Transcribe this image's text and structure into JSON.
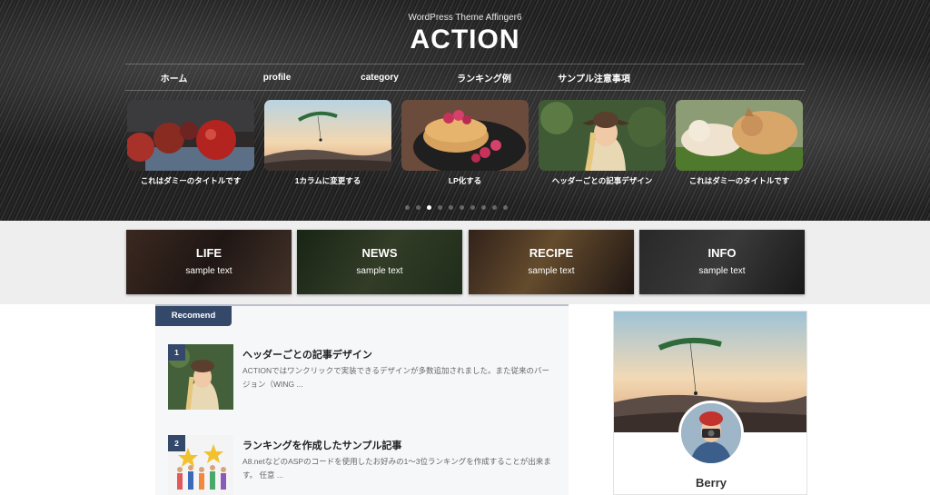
{
  "header": {
    "tagline": "WordPress Theme Affinger6",
    "logo": "ACTION"
  },
  "nav": {
    "items": [
      "ホーム",
      "profile",
      "category",
      "ランキング例",
      "サンプル注意事項"
    ]
  },
  "slider": {
    "slides": [
      {
        "caption": "これはダミーのタイトルです",
        "image": "apples"
      },
      {
        "caption": "1カラムに変更する",
        "image": "paraglider"
      },
      {
        "caption": "LP化する",
        "image": "pancakes"
      },
      {
        "caption": "ヘッダーごとの記事デザイン",
        "image": "woman-hat"
      },
      {
        "caption": "これはダミーのタイトルです",
        "image": "dog-cat"
      }
    ],
    "dots_total": 10,
    "active_dot": 2
  },
  "categories": [
    {
      "title": "LIFE",
      "sub": "sample text"
    },
    {
      "title": "NEWS",
      "sub": "sample text"
    },
    {
      "title": "RECIPE",
      "sub": "sample text"
    },
    {
      "title": "INFO",
      "sub": "sample text"
    }
  ],
  "recommend": {
    "tab_label": "Recomend",
    "items": [
      {
        "num": "1",
        "title": "ヘッダーごとの記事デザイン",
        "excerpt": "ACTIONではワンクリックで実装できるデザインが多数追加されました。また従来のバージョン（WING ..."
      },
      {
        "num": "2",
        "title": "ランキングを作成したサンプル記事",
        "excerpt": "A8.netなどのASPのコードを使用したお好みの1〜3位ランキングを作成することが出来ます。 任意 ..."
      }
    ]
  },
  "profile": {
    "name": "Berry"
  },
  "colors": {
    "accent": "#34496a",
    "band": "#eeeeee",
    "recommend_bg": "#f6f7f9"
  }
}
